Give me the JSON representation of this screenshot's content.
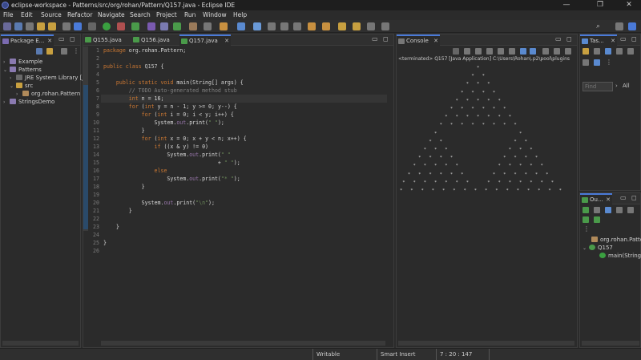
{
  "window": {
    "title": "eclipse-workspace - Patterns/src/org/rohan/Pattern/Q157.java - Eclipse IDE",
    "minimize": "—",
    "maximize": "❐",
    "close": "✕"
  },
  "menu": [
    "File",
    "Edit",
    "Source",
    "Refactor",
    "Navigate",
    "Search",
    "Project",
    "Run",
    "Window",
    "Help"
  ],
  "package_explorer": {
    "tab_label": "Package E...",
    "tree": [
      {
        "label": "Example",
        "indent": 0,
        "arrow": "›"
      },
      {
        "label": "Patterns",
        "indent": 0,
        "arrow": "⌄"
      },
      {
        "label": "JRE System Library [Ja",
        "indent": 1,
        "arrow": "›"
      },
      {
        "label": "src",
        "indent": 1,
        "arrow": "⌄"
      },
      {
        "label": "org.rohan.Pattern",
        "indent": 2,
        "arrow": "›"
      },
      {
        "label": "StringsDemo",
        "indent": 0,
        "arrow": "›"
      }
    ]
  },
  "editor": {
    "tabs": [
      {
        "label": "Q155.java"
      },
      {
        "label": "Q156.java"
      },
      {
        "label": "Q157.java"
      }
    ],
    "active_tab": 2,
    "line_numbers": [
      "1",
      "2",
      "3",
      "4",
      "5",
      "6",
      "7",
      "8",
      "9",
      "10",
      "11",
      "12",
      "13",
      "14",
      "15",
      "16",
      "17",
      "18",
      "19",
      "20",
      "21",
      "22",
      "23",
      "24",
      "25",
      "26"
    ]
  },
  "console": {
    "tab_label": "Console",
    "terminated": "<terminated> Q157 [Java Application] C:\\Users\\Rohan\\.p2\\pool\\plugins",
    "output": [
      "                             *",
      "                           *   *",
      "                         *   *   *",
      "                       *   *   *   *",
      "                     *   *   *   *   *",
      "                   *   *   *   *   *   *",
      "                 *   *   *   *   *   *   *",
      "               *   *   *   *   *   *   *   *",
      "             *                               *",
      "           *   *                           *   *",
      "         *   *   *                       *   *   *",
      "       *   *   *   *                   *   *   *   *",
      "     *   *   *   *   *               *   *   *   *   *",
      "   *   *   *   *   *   *           *   *   *   *   *   *",
      " *   *   *   *   *   *   *       *   *   *   *   *   *   *",
      "*   *   *   *   *   *   *   *   *   *   *   *   *   *   *   *"
    ]
  },
  "tasks": {
    "tab_label": "Tas...",
    "find_placeholder": "Find",
    "all_label": "All"
  },
  "outline": {
    "tab_label": "Ou...",
    "items": [
      {
        "label": "org.rohan.Patte"
      },
      {
        "label": "Q157"
      },
      {
        "label": "main(String[]"
      }
    ]
  },
  "status": {
    "writable": "Writable",
    "insert_mode": "Smart Insert",
    "position": "7 : 20 : 147"
  },
  "colors": {
    "accent": "#4a7ad8",
    "keyword": "#cc7832",
    "string": "#6a8759",
    "comment": "#808080"
  }
}
